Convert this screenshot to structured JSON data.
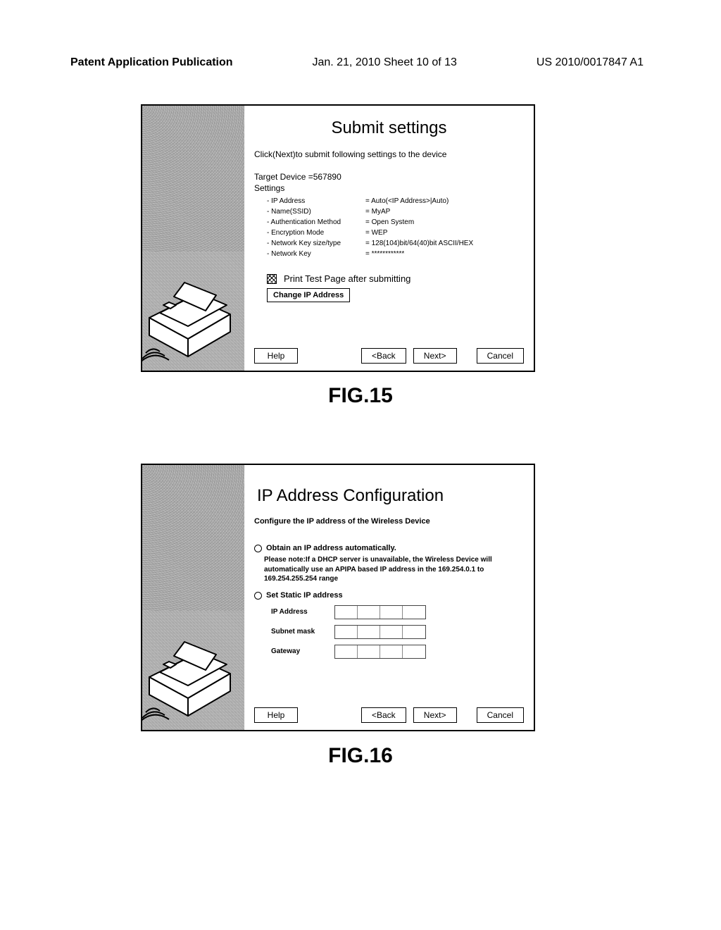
{
  "header": {
    "left": "Patent Application Publication",
    "center": "Jan. 21, 2010  Sheet 10 of 13",
    "right": "US 2010/0017847 A1"
  },
  "fig15": {
    "title": "Submit settings",
    "instruction": "Click(Next)to submit following settings to the device",
    "target_device_label": "Target Device =567890",
    "settings_heading": "Settings",
    "rows": [
      {
        "label": "- IP Address",
        "value": "= Auto(<IP Address>|Auto)"
      },
      {
        "label": "- Name(SSID)",
        "value": "= MyAP"
      },
      {
        "label": "- Authentication Method",
        "value": "= Open System"
      },
      {
        "label": "- Encryption Mode",
        "value": "= WEP"
      },
      {
        "label": "- Network Key size/type",
        "value": "= 128(104)bit/64(40)bit ASCII/HEX"
      },
      {
        "label": "- Network Key",
        "value": "= ************"
      }
    ],
    "print_test_label": "Print Test Page after submitting",
    "change_ip_label": "Change IP Address",
    "buttons": {
      "help": "Help",
      "back": "<Back",
      "next": "Next>",
      "cancel": "Cancel"
    },
    "caption": "FIG.15"
  },
  "fig16": {
    "title": "IP Address Configuration",
    "instruction": "Configure the IP address of the Wireless Device",
    "radio_auto_label": "Obtain an IP address automatically.",
    "radio_auto_note": "Please note:If a DHCP server is unavailable, the Wireless Device will automatically use an APIPA based IP address in the 169.254.0.1 to 169.254.255.254 range",
    "radio_static_label": "Set Static IP address",
    "ip_label": "IP Address",
    "subnet_label": "Subnet mask",
    "gateway_label": "Gateway",
    "buttons": {
      "help": "Help",
      "back": "<Back",
      "next": "Next>",
      "cancel": "Cancel"
    },
    "caption": "FIG.16"
  }
}
